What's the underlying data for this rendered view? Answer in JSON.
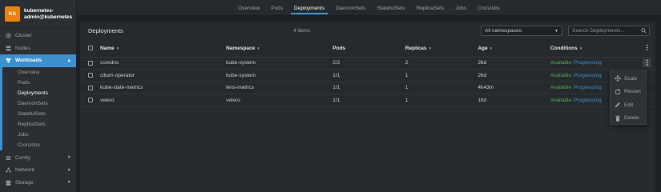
{
  "cluster": {
    "avatar": "KA",
    "name": "kubernetes-admin@kubernetes"
  },
  "sidebar": {
    "items": [
      {
        "label": "Cluster",
        "icon": "cluster-icon"
      },
      {
        "label": "Nodes",
        "icon": "nodes-icon"
      },
      {
        "label": "Workloads",
        "icon": "workloads-icon",
        "active": true
      },
      {
        "label": "Config",
        "icon": "config-icon"
      },
      {
        "label": "Network",
        "icon": "network-icon"
      },
      {
        "label": "Storage",
        "icon": "storage-icon"
      }
    ],
    "workloads_sub": [
      "Overview",
      "Pods",
      "Deployments",
      "DaemonSets",
      "StatefulSets",
      "ReplicaSets",
      "Jobs",
      "CronJobs"
    ],
    "active_sub": "Deployments"
  },
  "tabs": [
    "Overview",
    "Pods",
    "Deployments",
    "DaemonSets",
    "StatefulSets",
    "ReplicaSets",
    "Jobs",
    "CronJobs"
  ],
  "active_tab": "Deployments",
  "panel": {
    "title": "Deployments",
    "count": "4 items",
    "namespace_select": "All namespaces",
    "search_placeholder": "Search Deployments..."
  },
  "table": {
    "headers": {
      "name": "Name",
      "namespace": "Namespace",
      "pods": "Pods",
      "replicas": "Replicas",
      "age": "Age",
      "conditions": "Conditions"
    },
    "rows": [
      {
        "name": "coredns",
        "namespace": "kube-system",
        "pods": "2/2",
        "replicas": "2",
        "age": "26d",
        "available": "Available",
        "progressing": "Progressing"
      },
      {
        "name": "cilium-operator",
        "namespace": "kube-system",
        "pods": "1/1",
        "replicas": "1",
        "age": "26d",
        "available": "Available",
        "progressing": "Progressing"
      },
      {
        "name": "kube-state-metrics",
        "namespace": "lens-metrics",
        "pods": "1/1",
        "replicas": "1",
        "age": "4h43m",
        "available": "Available",
        "progressing": "Progressing"
      },
      {
        "name": "velero",
        "namespace": "velero",
        "pods": "1/1",
        "replicas": "1",
        "age": "16d",
        "available": "Available",
        "progressing": "Progressing"
      }
    ]
  },
  "context_menu": {
    "items": [
      {
        "label": "Scale",
        "icon": "scale-icon"
      },
      {
        "label": "Restart",
        "icon": "restart-icon"
      },
      {
        "label": "Edit",
        "icon": "edit-icon"
      },
      {
        "label": "Delete",
        "icon": "delete-icon"
      }
    ]
  },
  "colors": {
    "accent": "#3d90ce",
    "available": "#4caf50",
    "avatar": "#e8830f"
  }
}
